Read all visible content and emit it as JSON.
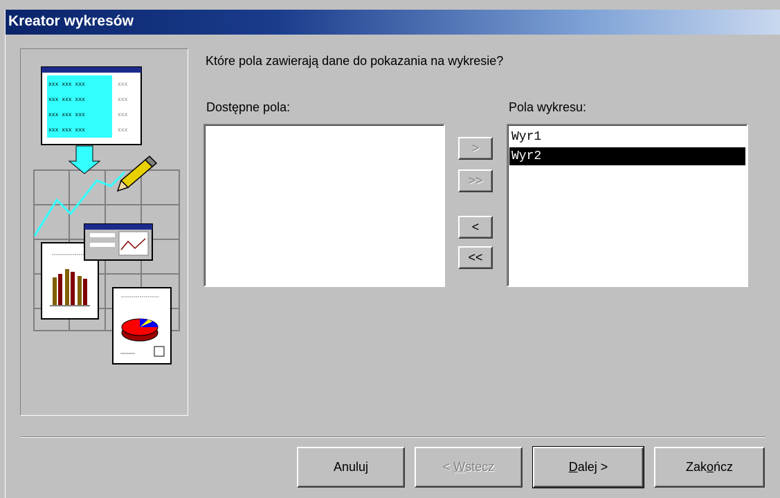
{
  "window": {
    "title": "Kreator wykresów"
  },
  "main": {
    "question": "Które pola zawierają dane do pokazania na wykresie?",
    "available_label": "Dostępne pola:",
    "chart_fields_label": "Pola wykresu:",
    "available_fields": [],
    "chart_fields": [
      {
        "label": "Wyr1",
        "selected": false
      },
      {
        "label": "Wyr2",
        "selected": true
      }
    ]
  },
  "move_buttons": {
    "add_one": ">",
    "add_all": ">>",
    "remove_one": "<",
    "remove_all": "<<"
  },
  "footer": {
    "cancel": "Anuluj",
    "back_prefix": "< ",
    "back_mnemonic": "W",
    "back_rest": "stecz",
    "next_mnemonic": "D",
    "next_rest": "alej >",
    "finish_prefix": "Zak",
    "finish_mnemonic": "o",
    "finish_rest": "ńcz"
  },
  "colors": {
    "face": "#c0c0c0",
    "title_start": "#0a246a",
    "selection": "#000000",
    "illustration_cyan": "#33ffff"
  }
}
